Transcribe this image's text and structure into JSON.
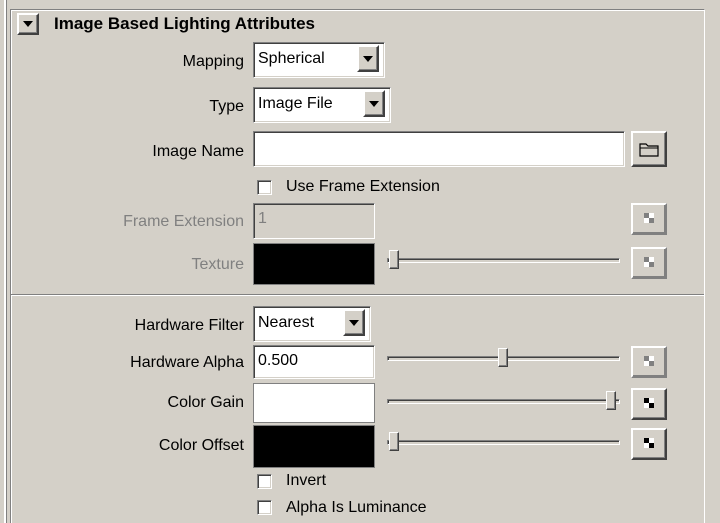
{
  "section": {
    "title": "Image Based Lighting Attributes"
  },
  "mapping": {
    "label": "Mapping",
    "value": "Spherical"
  },
  "type": {
    "label": "Type",
    "value": "Image File"
  },
  "image_name": {
    "label": "Image Name",
    "value": ""
  },
  "use_frame_extension": {
    "label": "Use Frame Extension",
    "checked": false
  },
  "frame_extension": {
    "label": "Frame Extension",
    "value": "1",
    "enabled": false
  },
  "texture": {
    "label": "Texture",
    "color": "#000000",
    "level": 0.0,
    "enabled": false
  },
  "hardware_filter": {
    "label": "Hardware Filter",
    "value": "Nearest"
  },
  "hardware_alpha": {
    "label": "Hardware Alpha",
    "value": "0.500",
    "level": 0.5
  },
  "color_gain": {
    "label": "Color Gain",
    "color": "#ffffff",
    "level": 1.0
  },
  "color_offset": {
    "label": "Color Offset",
    "color": "#000000",
    "level": 0.0
  },
  "invert": {
    "label": "Invert",
    "checked": false
  },
  "alpha_is_luminance": {
    "label": "Alpha Is Luminance",
    "checked": false
  },
  "icons": {
    "collapse": "triangle-down-icon",
    "browse": "folder-icon",
    "map": "checker-map-icon",
    "dropdown": "chevron-down-icon"
  }
}
